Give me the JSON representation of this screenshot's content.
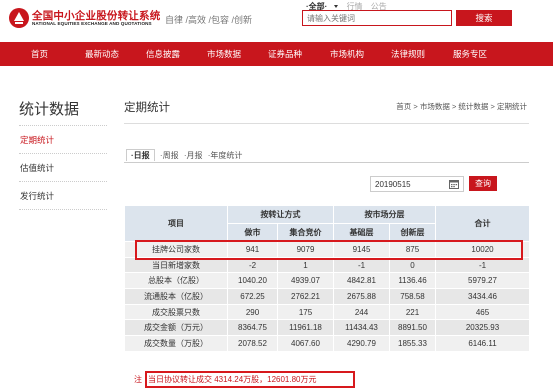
{
  "header": {
    "logo_cn": "全国中小企业股份转让系统",
    "logo_en": "NATIONAL EQUITIES EXCHANGE AND QUOTATIONS",
    "slogan": "自律 /高效 /包容 /创新",
    "search_tabs": [
      "·全部·",
      "行情",
      "公告"
    ],
    "search_placeholder": "请输入关键词",
    "search_button": "搜索",
    "brand_color": "#c8161d"
  },
  "nav": {
    "items": [
      "首页",
      "最新动态",
      "信息披露",
      "市场数据",
      "证券品种",
      "市场机构",
      "法律规则",
      "服务专区"
    ]
  },
  "sidebar": {
    "title": "统计数据",
    "items": [
      {
        "label": "定期统计",
        "active": true
      },
      {
        "label": "估值统计",
        "active": false
      },
      {
        "label": "发行统计",
        "active": false
      }
    ]
  },
  "main": {
    "title": "定期统计",
    "breadcrumb": [
      "首页",
      "市场数据",
      "统计数据",
      "定期统计"
    ],
    "breadcrumb_sep": ">",
    "subtabs": [
      {
        "label": "·日报",
        "active": true
      },
      {
        "label": "·周报",
        "active": false
      },
      {
        "label": "·月报",
        "active": false
      },
      {
        "label": "·年度统计",
        "active": false
      }
    ],
    "date_value": "20190515",
    "query_button": "查询"
  },
  "table": {
    "headers": {
      "item": "项目",
      "group1": "按转让方式",
      "group2": "按市场分层",
      "total": "合计",
      "sub": [
        "做市",
        "集合竞价",
        "基础层",
        "创新层"
      ]
    },
    "rows": [
      [
        "挂牌公司家数",
        "941",
        "9079",
        "9145",
        "875",
        "10020"
      ],
      [
        "当日新增家数",
        "-2",
        "1",
        "-1",
        "0",
        "-1"
      ],
      [
        "总股本（亿股）",
        "1040.20",
        "4939.07",
        "4842.81",
        "1136.46",
        "5979.27"
      ],
      [
        "流通股本（亿股）",
        "672.25",
        "2762.21",
        "2675.88",
        "758.58",
        "3434.46"
      ],
      [
        "成交股票只数",
        "290",
        "175",
        "244",
        "221",
        "465"
      ],
      [
        "成交金额（万元）",
        "8364.75",
        "11961.18",
        "11434.43",
        "8891.50",
        "20325.93"
      ],
      [
        "成交数量（万股）",
        "2078.52",
        "4067.60",
        "4290.79",
        "1855.33",
        "6146.11"
      ]
    ]
  },
  "note": {
    "label": "注",
    "text": "当日协议转让成交 4314.24万股，12601.80万元"
  }
}
